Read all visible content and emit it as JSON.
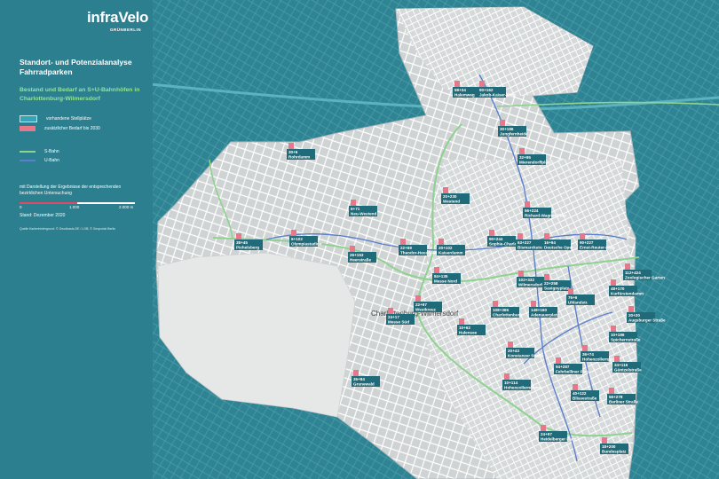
{
  "brand": {
    "name": "infraVelo",
    "sub": "GRÜNBERLIN"
  },
  "title": "Standort- und Potenzialanalyse Fahrradparken",
  "subtitle": "Bestand und Bedarf an S+U-Bahnhöfen in Charlottenburg-Wilmersdorf",
  "legend": {
    "existing": "vorhandene Stellplätze",
    "demand": "zusätzlicher Bedarf bis 2030",
    "sbahn": "S-Bahn",
    "ubahn": "U-Bahn",
    "colors": {
      "existing": "#3aa2b5",
      "demand": "#e6788a",
      "sbahn": "#8fd28f",
      "ubahn": "#5b7fcc"
    }
  },
  "note": "mit Darstellung der Ergebnisse der entsprechenden bezirklichen Untersuchung",
  "scale": {
    "start": "0",
    "mid": "1.000",
    "end": "2.000 m"
  },
  "date": "Stand: Dezember 2020",
  "source": "Quelle Kartenhintergrund: © Geodbasis-DE / LGB; © Geoportal Berlin",
  "district_label": "Charlottenburg-Wilmersdorf",
  "stations": [
    {
      "nums": "59+34",
      "name": "Halemweg"
    },
    {
      "nums": "90+162",
      "name": "Jakob-Kaiser-Platz"
    },
    {
      "nums": "30+186",
      "name": "Jungfernheide"
    },
    {
      "nums": "30+6",
      "name": "Rohrdamm"
    },
    {
      "nums": "32+95",
      "name": "Mierendorffplatz"
    },
    {
      "nums": "6+71",
      "name": "Neu-Westend"
    },
    {
      "nums": "20+230",
      "name": "Westend"
    },
    {
      "nums": "56+224",
      "name": "Richard-Wagner-Platz"
    },
    {
      "nums": "38+45",
      "name": "Pichelsberg"
    },
    {
      "nums": "6+102",
      "name": "Olympiastadion"
    },
    {
      "nums": "22+59",
      "name": "Theodor-Heuss-Platz"
    },
    {
      "nums": "20+102",
      "name": "Kaiserdamm"
    },
    {
      "nums": "90+244",
      "name": "Sophie-Charlotte-Platz"
    },
    {
      "nums": "63+227",
      "name": "Bismarckstraße"
    },
    {
      "nums": "16+94",
      "name": "Deutsche Oper"
    },
    {
      "nums": "90+227",
      "name": "Ernst-Reuter-Platz"
    },
    {
      "nums": "26+153",
      "name": "Heerstraße"
    },
    {
      "nums": "112+424",
      "name": "Zoologischer Garten"
    },
    {
      "nums": "84+135",
      "name": "Messe Nord"
    },
    {
      "nums": "102+332",
      "name": "Wilmersdorfer Straße"
    },
    {
      "nums": "22+258",
      "name": "Savignyplatz"
    },
    {
      "nums": "48+170",
      "name": "Kurfürstendamm"
    },
    {
      "nums": "76+6",
      "name": "Uhlandstr."
    },
    {
      "nums": "22+97",
      "name": "Westkreuz"
    },
    {
      "nums": "108+365",
      "name": "Charlottenburg"
    },
    {
      "nums": "148+160",
      "name": "Adenauerplatz"
    },
    {
      "nums": "20+20",
      "name": "Augsburger Straße"
    },
    {
      "nums": "24+17",
      "name": "Messe Süd"
    },
    {
      "nums": "10+62",
      "name": "Halensee"
    },
    {
      "nums": "10+186",
      "name": "Spichernstraße"
    },
    {
      "nums": "20+43",
      "name": "Konstanzer Straße"
    },
    {
      "nums": "36+74",
      "name": "Hohenzollernplatz"
    },
    {
      "nums": "34+116",
      "name": "Güntzelstraße"
    },
    {
      "nums": "35+84",
      "name": "Grunewald"
    },
    {
      "nums": "10+114",
      "name": "Hohenzollerndamm"
    },
    {
      "nums": "94+287",
      "name": "Fehrbelliner Platz"
    },
    {
      "nums": "40+122",
      "name": "Blissestraße"
    },
    {
      "nums": "56+278",
      "name": "Berliner Straße"
    },
    {
      "nums": "24+97",
      "name": "Heidelberger Platz"
    },
    {
      "nums": "18+200",
      "name": "Bundesplatz"
    }
  ]
}
